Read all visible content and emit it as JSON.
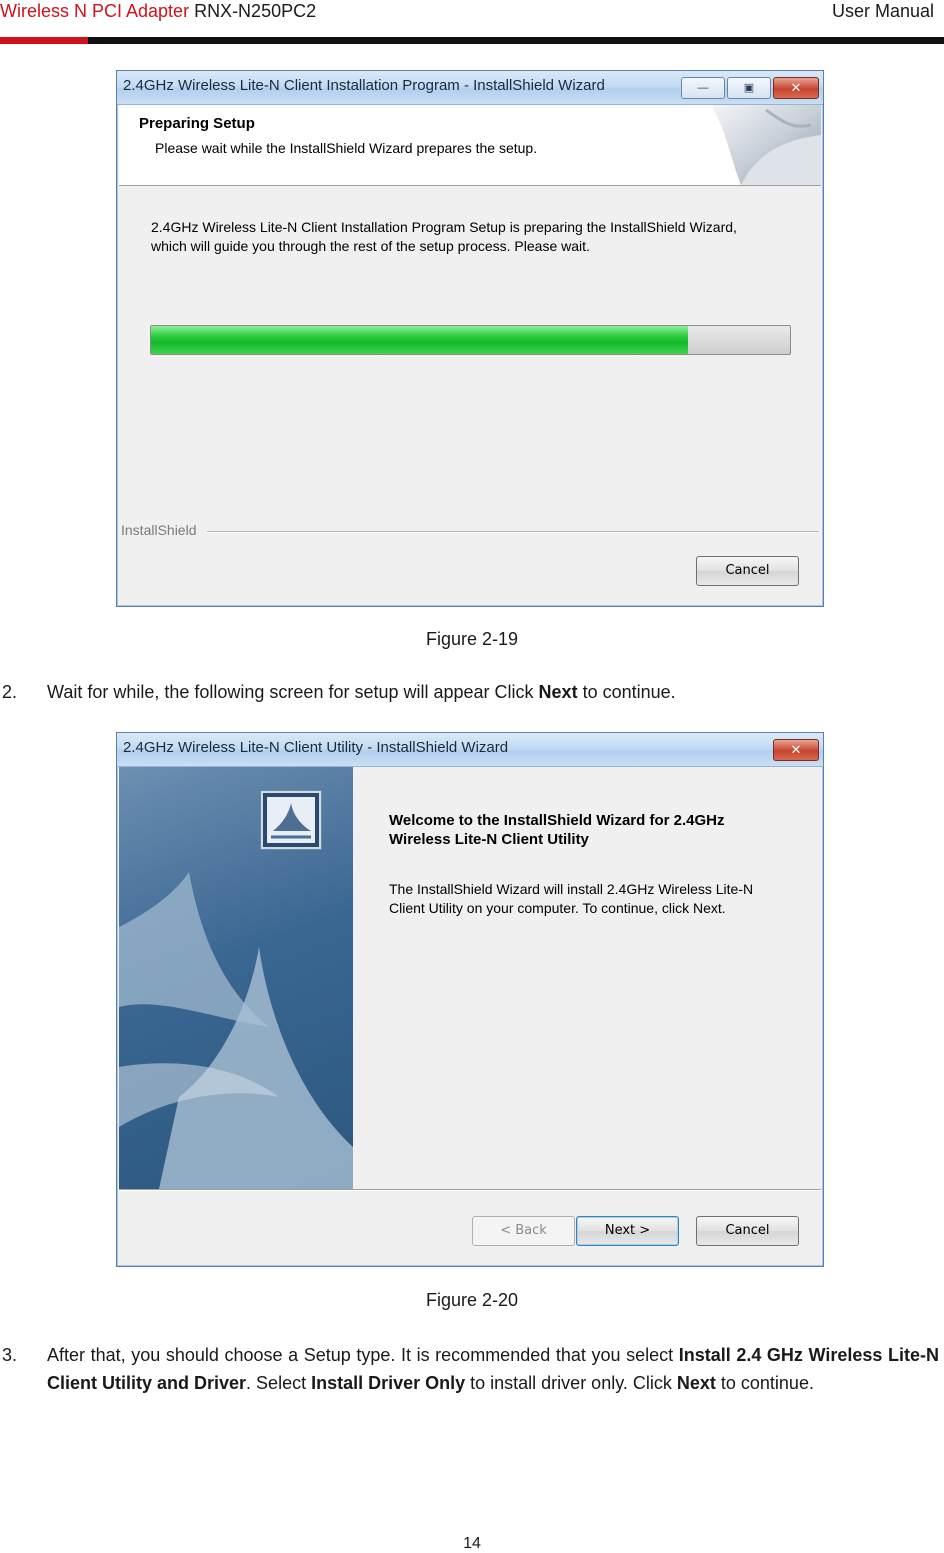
{
  "header": {
    "product_red": "Wireless N PCI Adapter",
    "model": " RNX-N250PC2",
    "doc_type": "User Manual"
  },
  "figure19": {
    "window_title": "2.4GHz Wireless Lite-N Client Installation Program - InstallShield Wizard",
    "banner_heading": "Preparing Setup",
    "banner_subtext": "Please wait while the InstallShield Wizard prepares the setup.",
    "body_line1": "2.4GHz Wireless Lite-N Client Installation Program Setup is preparing the InstallShield Wizard,",
    "body_line2": "which will guide you through the rest of the setup process. Please wait.",
    "progress_percent": 84,
    "brand": "InstallShield",
    "cancel_label": "Cancel",
    "caption": "Figure 2-19"
  },
  "step2": {
    "number": "2.",
    "text_before": "Wait for while, the following screen for setup will appear Click ",
    "bold": "Next",
    "text_after": " to continue."
  },
  "figure20": {
    "window_title": "2.4GHz Wireless Lite-N Client Utility - InstallShield Wizard",
    "welcome_line1": "Welcome to the InstallShield Wizard for 2.4GHz",
    "welcome_line2": "Wireless Lite-N Client Utility",
    "body_line1": "The InstallShield Wizard will install 2.4GHz Wireless Lite-N",
    "body_line2": "Client Utility on your computer.  To continue, click Next.",
    "back_label": "< Back",
    "next_label": "Next >",
    "cancel_label": "Cancel",
    "caption": "Figure 2-20"
  },
  "step3": {
    "number": "3.",
    "t1": "After that, you should choose a Setup type. It is recommended that you select ",
    "b1": "Install 2.4 GHz Wireless Lite-N Client Utility and Driver",
    "t2": ". Select ",
    "b2": "Install Driver Only",
    "t3": " to install driver only. Click ",
    "b3": "Next",
    "t4": " to continue."
  },
  "page_number": "14"
}
